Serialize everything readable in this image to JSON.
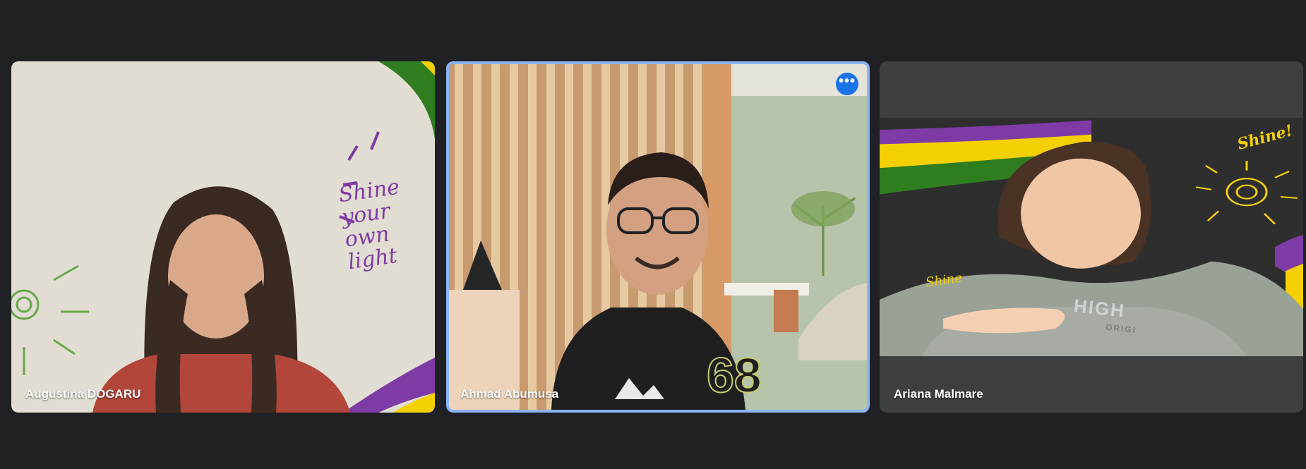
{
  "participants": [
    {
      "name": "Augustina DOGARU",
      "background_text": "Shine your own light"
    },
    {
      "name": "Ahmad Abumusa",
      "jersey_number": "68",
      "more_options_icon": "more-horiz-icon"
    },
    {
      "name": "Ariana Malmare",
      "sticker_text": "Shine!",
      "shirt_text": "HIGH",
      "shirt_subtext": "ORIGI",
      "background_text": "Shine"
    }
  ],
  "colors": {
    "page_background": "#202124",
    "active_speaker_border": "#8ab4f8",
    "more_button": "#1a73e8",
    "accent_purple": "#7e3ba6",
    "accent_yellow": "#f4d000",
    "accent_green": "#2f7d1f"
  }
}
